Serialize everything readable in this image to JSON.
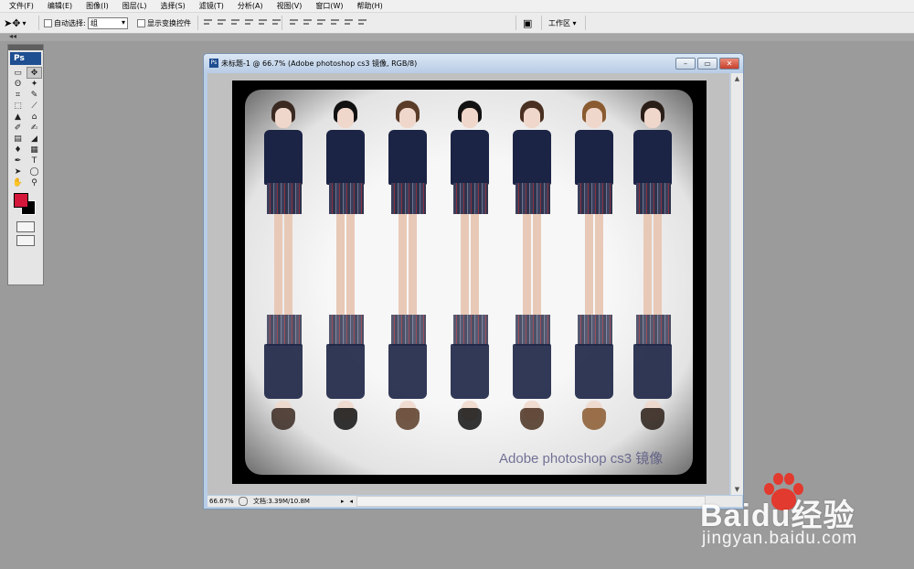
{
  "menu": [
    "文件(F)",
    "编辑(E)",
    "图像(I)",
    "图层(L)",
    "选择(S)",
    "滤镜(T)",
    "分析(A)",
    "视图(V)",
    "窗口(W)",
    "帮助(H)"
  ],
  "options_bar": {
    "auto_select_label": "自动选择:",
    "auto_select_value": "组",
    "show_transform_label": "显示变换控件",
    "workspace_label": "工作区 ▾"
  },
  "toolbox": {
    "logo": "Ps",
    "tools": [
      "▭",
      "✥",
      "ʘ",
      "✦",
      "⌗",
      "✎",
      "⬚",
      "⟋",
      "▲",
      "⌂",
      "✐",
      "✍",
      "▤",
      "◢",
      "♦",
      "▦",
      "✒",
      "T",
      "➤",
      "◯",
      "✋",
      "⚲"
    ]
  },
  "colors": {
    "foreground": "#d4173a",
    "background": "#000000"
  },
  "document": {
    "title": "未标题-1 @ 66.7% (Adobe photoshop cs3 镜像, RGB/8)",
    "watermark_text": "Adobe photoshop cs3 镜像",
    "zoom": "66.67%",
    "doc_size": "文档:3.39M/10.8M"
  },
  "branding": {
    "name": "Baidu经验",
    "url": "jingyan.baidu.com"
  }
}
